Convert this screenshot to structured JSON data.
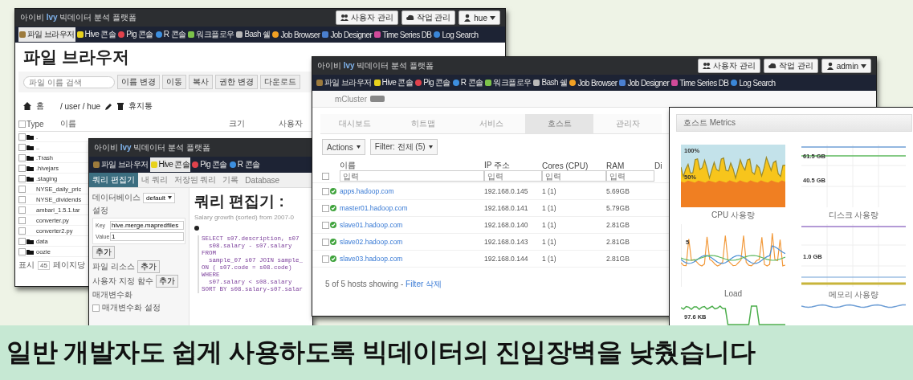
{
  "file_browser": {
    "title": {
      "prefix": "아이비",
      "brand": "Ivy",
      "suffix": "빅데이터 분석 플랫폼"
    },
    "header_buttons": [
      {
        "kind": "users",
        "label": "사용자 관리"
      },
      {
        "kind": "jobs",
        "label": "작업 관리"
      },
      {
        "kind": "account",
        "label": "hue"
      }
    ],
    "nav": [
      {
        "label": "파일 브라우저",
        "selected": true
      },
      {
        "label": "Hive 콘솔",
        "selected": false
      },
      {
        "label": "Pig 콘솔",
        "selected": false
      },
      {
        "label": "R 콘솔",
        "selected": false
      },
      {
        "label": "워크플로우",
        "selected": false
      },
      {
        "label": "Bash 쉘",
        "selected": false
      },
      {
        "label": "Job Browser",
        "selected": false
      },
      {
        "label": "Job Designer",
        "selected": false
      },
      {
        "label": "Time Series DB",
        "selected": false
      },
      {
        "label": "Log Search",
        "selected": false
      }
    ],
    "heading": "파일 브라우저",
    "search": {
      "placeholder": "파일 이름 검색"
    },
    "toolbar": [
      "이름 변경",
      "이동",
      "복사",
      "권한 변경",
      "다운로드"
    ],
    "breadcrumb": {
      "home": "홈",
      "path": "/ user / hue",
      "trash": "휴지통"
    },
    "select_all": {
      "checked": false
    },
    "columns": [
      "Type",
      "이름",
      "크기",
      "사용자"
    ],
    "rows": [
      {
        "kind": "folder",
        "name": ".",
        "checked": false
      },
      {
        "kind": "folder",
        "name": "..",
        "checked": false
      },
      {
        "kind": "folder",
        "name": ".Trash",
        "checked": false
      },
      {
        "kind": "folder",
        "name": ".hivejars",
        "checked": false
      },
      {
        "kind": "folder",
        "name": ".staging",
        "checked": false
      },
      {
        "kind": "file",
        "name": "NYSE_daily_pric",
        "checked": false
      },
      {
        "kind": "file",
        "name": "NYSE_dividends",
        "checked": false
      },
      {
        "kind": "file",
        "name": "ambari_1.5.1.tar",
        "checked": false
      },
      {
        "kind": "file",
        "name": "converter.py",
        "checked": false
      },
      {
        "kind": "file",
        "name": "converter2.py",
        "checked": false
      },
      {
        "kind": "folder",
        "name": "data",
        "checked": false
      },
      {
        "kind": "folder",
        "name": "oozie",
        "checked": false
      }
    ],
    "footer": {
      "show": "표시",
      "page_size": "45",
      "per_page": "페이지당"
    }
  },
  "hive_editor": {
    "title": {
      "prefix": "아이비",
      "brand": "Ivy",
      "suffix": "빅데이터 분석 플랫폼"
    },
    "nav": [
      {
        "label": "파일 브라우저",
        "selected": false
      },
      {
        "label": "Hive 콘솔",
        "selected": true
      },
      {
        "label": "Pig 콘솔",
        "selected": false
      },
      {
        "label": "R 콘솔",
        "selected": false
      }
    ],
    "tabs": [
      {
        "label": "쿼리 편집기",
        "selected": true
      },
      {
        "label": "내 쿼리",
        "selected": false
      },
      {
        "label": "저장된 쿼리",
        "selected": false
      },
      {
        "label": "기록",
        "selected": false
      },
      {
        "label": "Database",
        "selected": false
      }
    ],
    "database": {
      "label": "데이터베이스",
      "value": "default"
    },
    "settings": {
      "label": "설정",
      "key_label": "Key",
      "key_value": "hive.merge.mapredfiles",
      "value_label": "Value",
      "value_value": "1",
      "add": "추가"
    },
    "resources": [
      {
        "label": "파일 리소스",
        "button": "추가"
      },
      {
        "label": "사용자 지정 함수",
        "button": "추가"
      }
    ],
    "parameterization": {
      "label": "매개변수화",
      "option": "매개변수화 설정",
      "checked": false
    },
    "heading": "쿼리 편집기 :",
    "subtitle": "Salary growth (sorted) from 2007-0",
    "code": [
      "SELECT s07.description, s07",
      "  s08.salary - s07.salary",
      "FROM",
      "  sample_07 s07 JOIN sample_",
      "ON ( s07.code = s08.code)",
      "WHERE",
      "  s07.salary < s08.salary",
      "SORT BY s08.salary-s07.salar"
    ]
  },
  "cluster_hosts": {
    "title": {
      "prefix": "아이비",
      "brand": "Ivy",
      "suffix": "빅데이터 분석 플랫폼"
    },
    "header_buttons": [
      {
        "kind": "users",
        "label": "사용자 관리"
      },
      {
        "kind": "jobs",
        "label": "작업 관리"
      },
      {
        "kind": "account",
        "label": "admin"
      }
    ],
    "nav": [
      {
        "label": "파일 브라우저",
        "selected": false
      },
      {
        "label": "Hive 콘솔",
        "selected": false
      },
      {
        "label": "Pig 콘솔",
        "selected": false
      },
      {
        "label": "R 콘솔",
        "selected": false
      },
      {
        "label": "워크플로우",
        "selected": false
      },
      {
        "label": "Bash 쉘",
        "selected": false
      },
      {
        "label": "Job Browser",
        "selected": false
      },
      {
        "label": "Job Designer",
        "selected": false
      },
      {
        "label": "Time Series DB",
        "selected": false
      },
      {
        "label": "Log Search",
        "selected": false
      }
    ],
    "cluster_name": "mCluster",
    "tabs": [
      {
        "label": "대시보드",
        "selected": false
      },
      {
        "label": "히트맵",
        "selected": false
      },
      {
        "label": "서비스",
        "selected": false
      },
      {
        "label": "호스트",
        "selected": true
      },
      {
        "label": "관리자",
        "selected": false
      }
    ],
    "actions": "Actions",
    "filter": "Filter: 전체 (5)",
    "select_all": {
      "checked": false
    },
    "columns": [
      "이름",
      "IP 주소",
      "Cores (CPU)",
      "RAM",
      "Di"
    ],
    "filters": [
      {
        "placeholder": "입력"
      },
      {
        "placeholder": "입력"
      },
      {
        "placeholder": "입력"
      },
      {
        "placeholder": "입력"
      }
    ],
    "hosts": [
      {
        "name": "apps.hadoop.com",
        "ip": "192.168.0.145",
        "cores": "1 (1)",
        "ram": "5.69GB",
        "online": true,
        "checked": false
      },
      {
        "name": "master01.hadoop.com",
        "ip": "192.168.0.141",
        "cores": "1 (1)",
        "ram": "5.79GB",
        "online": true,
        "checked": false
      },
      {
        "name": "slave01.hadoop.com",
        "ip": "192.168.0.140",
        "cores": "1 (1)",
        "ram": "2.81GB",
        "online": true,
        "checked": false
      },
      {
        "name": "slave02.hadoop.com",
        "ip": "192.168.0.143",
        "cores": "1 (1)",
        "ram": "2.81GB",
        "online": true,
        "checked": false
      },
      {
        "name": "slave03.hadoop.com",
        "ip": "192.168.0.144",
        "cores": "1 (1)",
        "ram": "2.81GB",
        "online": true,
        "checked": false
      }
    ],
    "footer": {
      "text": "5 of 5 hosts showing - ",
      "link": "Filter 삭제"
    }
  },
  "host_metrics": {
    "title": "호스트 Metrics",
    "panels": [
      {
        "kind": "cpu_area",
        "labels": [
          "100%",
          "50%"
        ],
        "caption": "CPU 사용량"
      },
      {
        "kind": "flat_lines",
        "labels": [
          "61.5 GB",
          "40.5 GB"
        ],
        "caption": "디스크 사용량"
      },
      {
        "kind": "spiky_lines",
        "labels": [
          "5"
        ],
        "caption": "Load"
      },
      {
        "kind": "band_lines",
        "labels": [
          "1.0 GB"
        ],
        "caption": "메모리 사용량"
      },
      {
        "kind": "step_line",
        "labels": [
          "97.6 KB"
        ]
      },
      {
        "kind": "wavy_line"
      }
    ]
  },
  "caption": {
    "text": "일반 개발자도 쉽게 사용하도록 빅데이터의 진입장벽을 낮췄습니다"
  }
}
